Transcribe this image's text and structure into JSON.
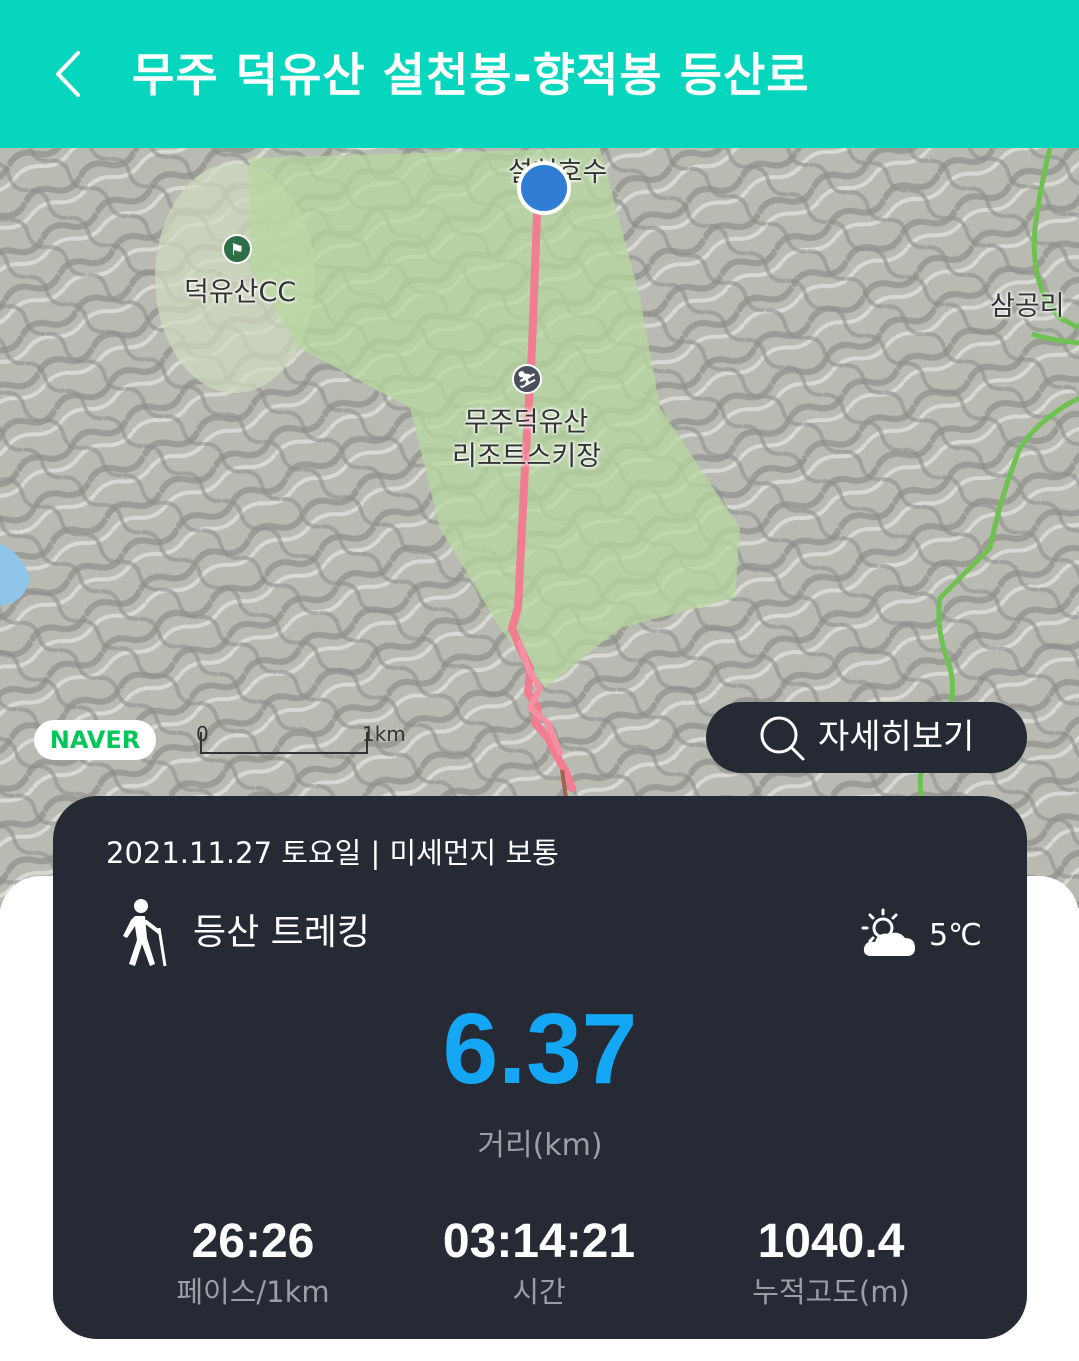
{
  "header": {
    "title": "무주 덕유산 설천봉-향적봉 등산로",
    "back_icon": "chevron-left-icon",
    "background_color": "#06d6bd"
  },
  "map": {
    "labels": {
      "lake": "설천호수",
      "golf_course": "덕유산CC",
      "ski_resort_line1": "무주덕유산",
      "ski_resort_line2": "리조트스키장",
      "village": "삼공리"
    },
    "brand": "NAVER",
    "scale": {
      "zero": "0",
      "distance": "1km"
    },
    "route_color": "#f27d92",
    "start_marker_color": "#2f7ed3"
  },
  "detail_button": {
    "label": "자세히보기",
    "icon": "search-icon"
  },
  "summary": {
    "date_line": "2021.11.27  토요일  |  미세먼지  보통",
    "activity": "등산 트레킹",
    "activity_icon": "hiker-icon",
    "weather_icon": "partly-cloudy-icon",
    "temperature": "5℃",
    "distance": "6.37",
    "distance_label": "거리(km)",
    "accent_color": "#13a7f5",
    "stats": [
      {
        "value": "26:26",
        "label": "페이스/1km"
      },
      {
        "value": "03:14:21",
        "label": "시간"
      },
      {
        "value": "1040.4",
        "label": "누적고도(m)"
      }
    ]
  }
}
